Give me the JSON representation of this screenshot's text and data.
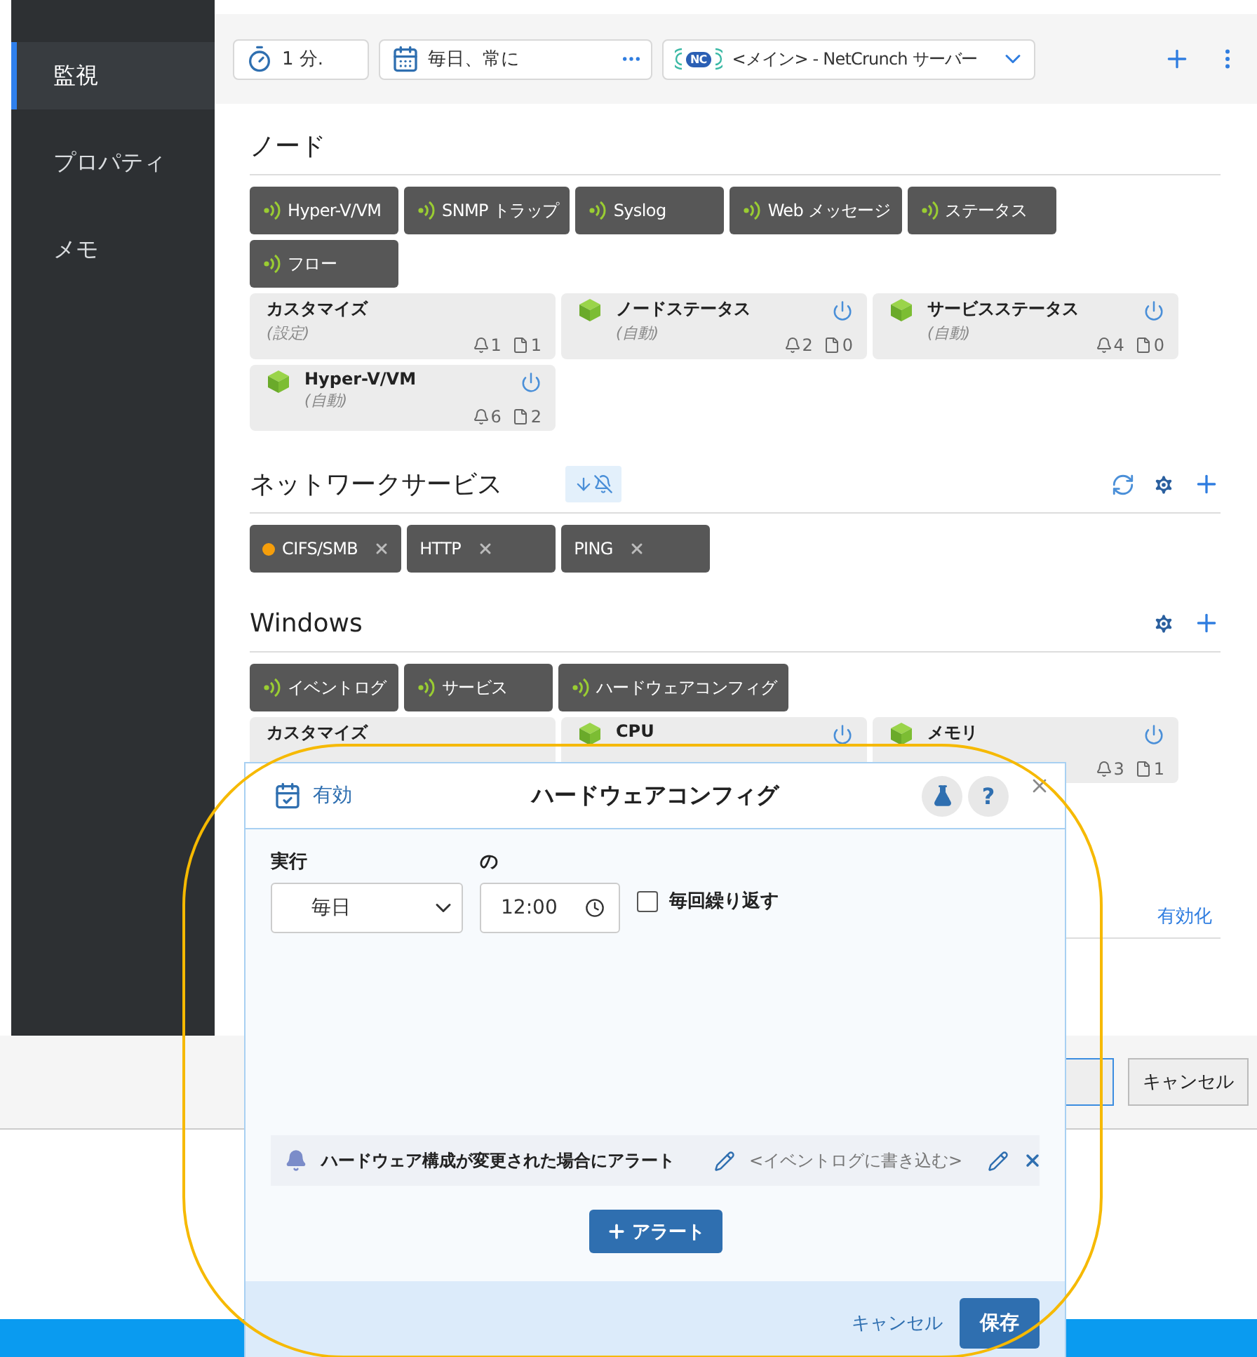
{
  "sidebar": {
    "items": [
      {
        "label": "監視",
        "selected": true
      },
      {
        "label": "プロパティ",
        "selected": false
      },
      {
        "label": "メモ",
        "selected": false
      }
    ]
  },
  "toolbar": {
    "interval": "1 分.",
    "schedule": "毎日、常に",
    "server": {
      "logo_text": "NC",
      "label": "<メイン> - NetCrunch サーバー"
    }
  },
  "sections": [
    {
      "title": "ノード",
      "chips": [
        {
          "label": "Hyper-V/VM",
          "kind": "sensor"
        },
        {
          "label": "SNMP トラップ",
          "kind": "sensor"
        },
        {
          "label": "Syslog",
          "kind": "sensor"
        },
        {
          "label": "Web メッセージ",
          "kind": "sensor"
        },
        {
          "label": "ステータス",
          "kind": "sensor"
        },
        {
          "label": "フロー",
          "kind": "sensor"
        }
      ],
      "cards": [
        {
          "kind": "custom",
          "title": "カスタマイズ",
          "subtitle": "(設定)",
          "alerts": "1",
          "files": "1"
        },
        {
          "kind": "monitor",
          "title": "ノードステータス",
          "subtitle": "(自動)",
          "alerts": "2",
          "files": "0"
        },
        {
          "kind": "monitor",
          "title": "サービスステータス",
          "subtitle": "(自動)",
          "alerts": "4",
          "files": "0"
        },
        {
          "kind": "monitor",
          "title": "Hyper-V/VM",
          "subtitle": "(自動)",
          "alerts": "6",
          "files": "2"
        }
      ]
    },
    {
      "title": "ネットワークサービス",
      "filter_toggle": true,
      "actions": [
        {
          "kind": "refresh"
        },
        {
          "kind": "settings"
        },
        {
          "kind": "add"
        }
      ],
      "chips": [
        {
          "label": "CIFS/SMB",
          "kind": "service",
          "color": "#f59e0b"
        },
        {
          "label": "HTTP",
          "kind": "service"
        },
        {
          "label": "PING",
          "kind": "service"
        }
      ]
    },
    {
      "title": "Windows",
      "actions": [
        {
          "kind": "settings"
        },
        {
          "kind": "add"
        }
      ],
      "chips": [
        {
          "label": "イベントログ",
          "kind": "sensor"
        },
        {
          "label": "サービス",
          "kind": "sensor"
        },
        {
          "label": "ハードウェアコンフィグ",
          "kind": "sensor"
        }
      ],
      "cards": [
        {
          "kind": "custom",
          "title": "カスタマイズ"
        },
        {
          "kind": "monitor",
          "title": "CPU"
        },
        {
          "kind": "monitor",
          "title": "メモリ",
          "alerts": "3",
          "files": "1"
        }
      ]
    }
  ],
  "enable_link": "有効化",
  "footer": {
    "cancel": "キャンセル"
  },
  "dialog": {
    "enabled_label": "有効",
    "title": "ハードウェアコンフィグ",
    "help": "?",
    "run_label": "実行",
    "at_label": "の",
    "frequency": "毎日",
    "time": "12:00",
    "repeat": {
      "label": "毎回繰り返す",
      "checked": false
    },
    "alerts": [
      {
        "text": "ハードウェア構成が変更された場合にアラート",
        "action": "<イベントログに書き込む>"
      }
    ],
    "add_alert": "アラート",
    "cancel": "キャンセル",
    "save": "保存"
  }
}
